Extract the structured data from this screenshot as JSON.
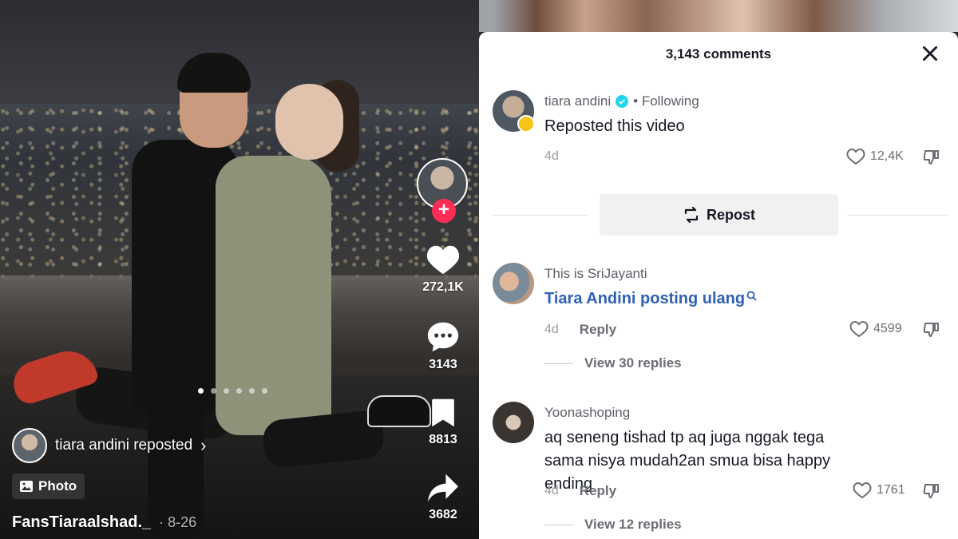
{
  "video": {
    "actions": {
      "likes": "272,1K",
      "comments": "3143",
      "saves": "8813",
      "shares": "3682"
    },
    "carousel": {
      "total": 6,
      "active": 0
    },
    "repost_label": "tiara andini reposted",
    "repost_chevron": "›",
    "photo_badge": "Photo",
    "author": "FansTiaraalshad._",
    "date": "· 8-26",
    "follow_plus": "+"
  },
  "comments_panel": {
    "title": "3,143 comments",
    "close_icon": "close-icon",
    "repost_button": "Repost",
    "comments": [
      {
        "name": "tiara andini",
        "verified": true,
        "following": "• Following",
        "text": "Reposted this video",
        "age": "4d",
        "likes": "12,4K"
      },
      {
        "name": "This is SriJayanti",
        "text": "Tiara Andini posting ulang",
        "text_color": "#2f5fb6",
        "age": "4d",
        "reply": "Reply",
        "likes": "4599",
        "view_replies": "View 30 replies"
      },
      {
        "name": "Yoonashoping",
        "text": "aq seneng tishad tp aq juga nggak tega sama nisya mudah2an smua bisa happy ending",
        "age": "4d",
        "reply": "Reply",
        "likes": "1761",
        "view_replies": "View 12 replies"
      }
    ]
  },
  "colors": {
    "accent_pink": "#fe2c55",
    "verified_blue": "#20d5ec",
    "link_blue": "#2f5fb6"
  }
}
